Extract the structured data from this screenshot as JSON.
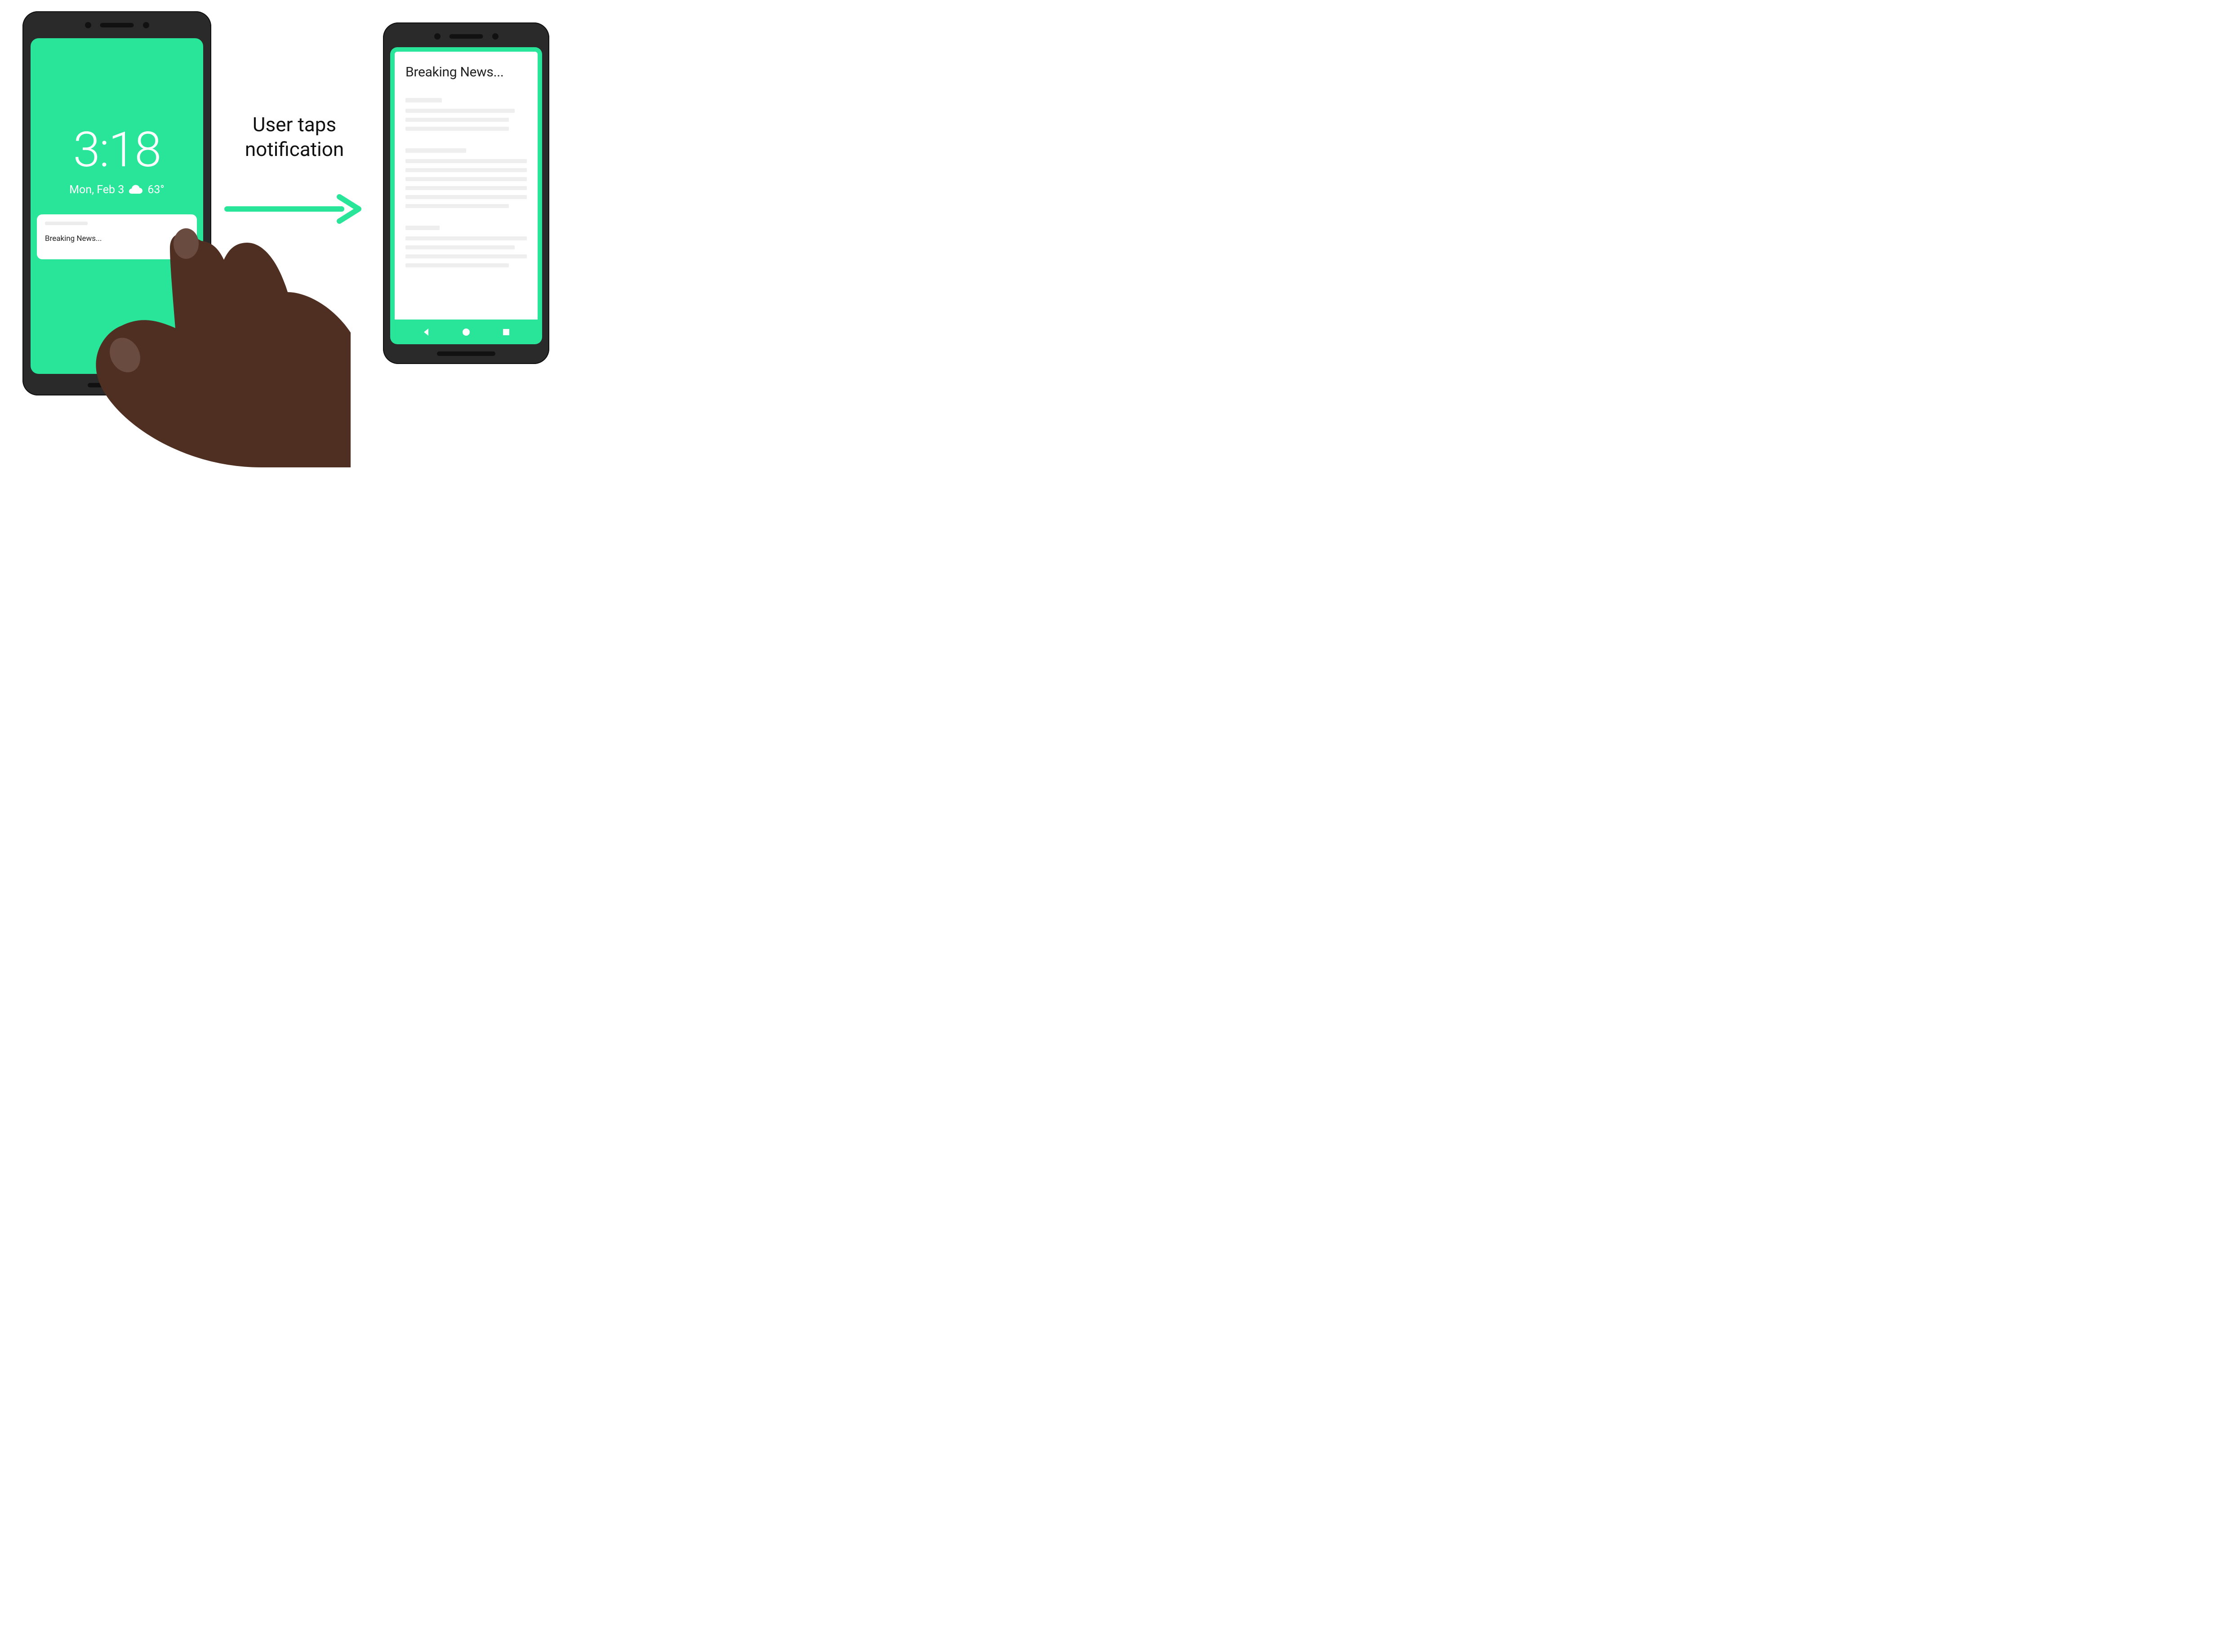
{
  "caption": "User taps notification",
  "lock_screen": {
    "time": "3:18",
    "date": "Mon, Feb 3",
    "weather_icon": "cloud",
    "temperature": "63°",
    "notification_title": "Breaking News..."
  },
  "article_screen": {
    "title": "Breaking News..."
  },
  "nav": {
    "back": "back",
    "home": "home",
    "recents": "recents"
  },
  "colors": {
    "accent": "#29e59a",
    "frame": "#2a2a2a",
    "ink": "#222222",
    "hand_skin": "#4f2f21",
    "hand_nail": "#6a4b3f"
  }
}
